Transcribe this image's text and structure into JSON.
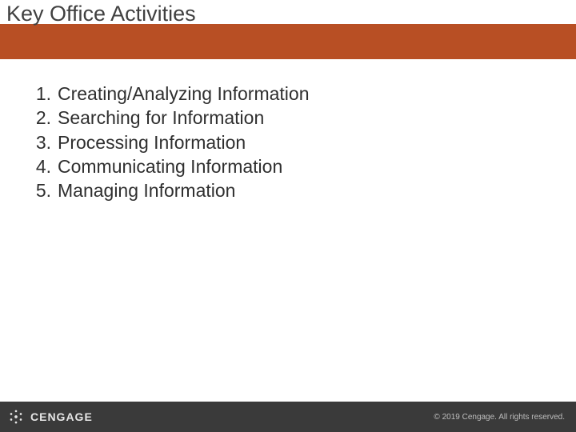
{
  "slide": {
    "title": "Key Office Activities"
  },
  "activities": {
    "items": [
      {
        "label": "Creating/Analyzing Information"
      },
      {
        "label": "Searching for Information"
      },
      {
        "label": "Processing Information"
      },
      {
        "label": "Communicating Information"
      },
      {
        "label": "Managing Information"
      }
    ]
  },
  "footer": {
    "brand": "CENGAGE",
    "copyright": "© 2019 Cengage. All rights reserved."
  },
  "colors": {
    "accent": "#b84f24",
    "footer_bg": "#3a3a3a",
    "text": "#404040"
  }
}
